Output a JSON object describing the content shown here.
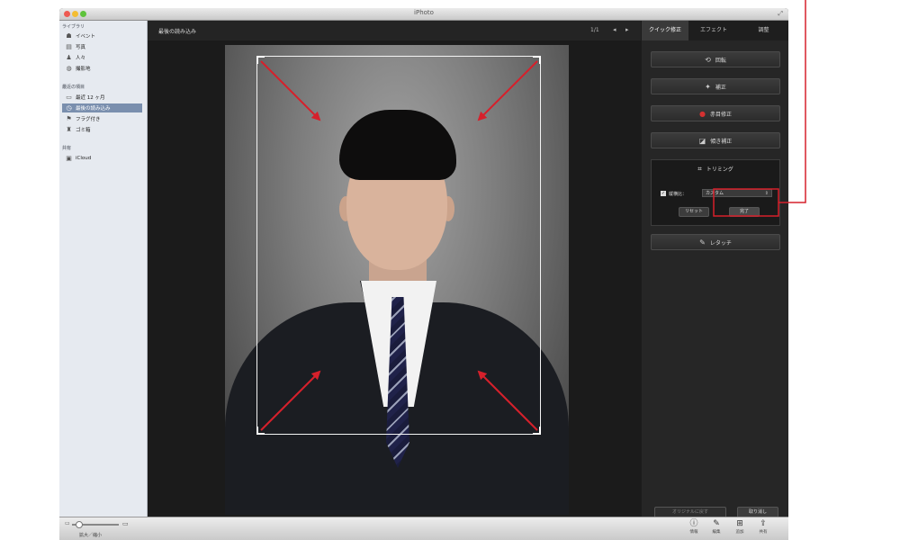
{
  "window": {
    "title": "iPhoto",
    "fullscreen_icon": "fullscreen-arrows-icon",
    "traffic_lights": {
      "close": "#ee5a52",
      "minimize": "#f4bd31",
      "zoom": "#5fc33c"
    }
  },
  "sidebar": {
    "sections": [
      {
        "label": "ライブラリ",
        "items": [
          {
            "label": "イベント",
            "icon": "event-icon",
            "glyph": "☗"
          },
          {
            "label": "写真",
            "icon": "photos-icon",
            "glyph": "▤"
          },
          {
            "label": "人々",
            "icon": "people-icon",
            "glyph": "♟"
          },
          {
            "label": "撮影地",
            "icon": "places-icon",
            "glyph": "◍"
          }
        ]
      },
      {
        "label": "最近の項目",
        "items": [
          {
            "label": "最近 12 ヶ月",
            "icon": "calendar-icon",
            "glyph": "▭"
          },
          {
            "label": "最後の読み込み",
            "icon": "last-import-icon",
            "glyph": "◷",
            "selected": true
          },
          {
            "label": "フラグ付き",
            "icon": "flag-icon",
            "glyph": "⚑"
          },
          {
            "label": "ゴミ箱",
            "icon": "trash-icon",
            "glyph": "♜"
          }
        ]
      },
      {
        "label": "共有",
        "items": [
          {
            "label": "iCloud",
            "icon": "icloud-icon",
            "glyph": "▣"
          }
        ]
      }
    ]
  },
  "toolbar": {
    "breadcrumb": "最後の読み込み",
    "count": "1/1",
    "prev_glyph": "◂",
    "next_glyph": "▸"
  },
  "panel": {
    "tabs": [
      "クイック修正",
      "エフェクト",
      "調整"
    ],
    "active_tab": 0,
    "buttons": [
      {
        "label": "回転",
        "icon": "rotate-icon",
        "glyph": "⟲"
      },
      {
        "label": "補正",
        "icon": "enhance-icon",
        "glyph": "✦"
      },
      {
        "label": "赤目修正",
        "icon": "red-eye-icon",
        "glyph": "●"
      },
      {
        "label": "傾き補正",
        "icon": "straighten-icon",
        "glyph": "◪"
      }
    ],
    "trim": {
      "title": "トリミング",
      "icon": "crop-icon",
      "glyph": "⌗",
      "constrain_label": "縦横比：",
      "constrain_checked": true,
      "constrain_value": "カスタム",
      "reset_label": "リセット",
      "done_label": "完了"
    },
    "retouch": {
      "label": "レタッチ",
      "icon": "retouch-brush-icon",
      "glyph": "✎"
    },
    "revert_label": "オリジナルに戻す",
    "undo_label": "取り消し"
  },
  "bottombar": {
    "zoom_label": "拡大／縮小",
    "buttons": [
      {
        "label": "情報",
        "icon": "info-icon",
        "glyph": "ⓘ"
      },
      {
        "label": "編集",
        "icon": "edit-pencil-icon",
        "glyph": "✎"
      },
      {
        "label": "追加",
        "icon": "add-icon",
        "glyph": "⊞"
      },
      {
        "label": "共有",
        "icon": "share-icon",
        "glyph": "⇪"
      }
    ]
  },
  "colors": {
    "annotation": "#d6202b",
    "selected_sidebar": "#7a8fae"
  }
}
